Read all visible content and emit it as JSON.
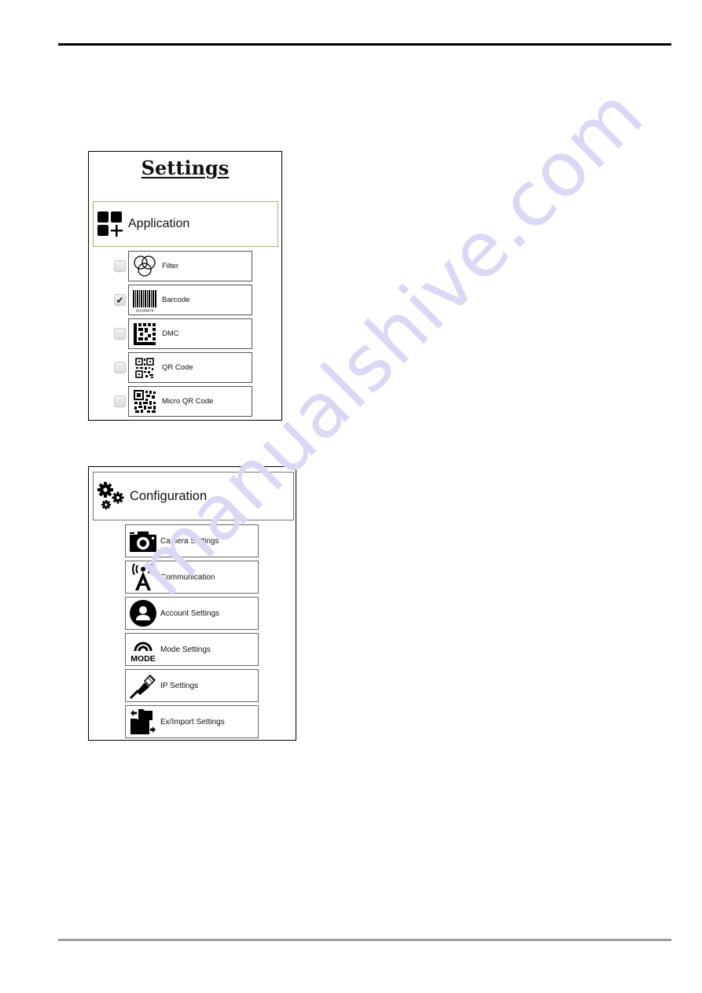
{
  "settings_panel": {
    "title": "Settings",
    "application_header": {
      "label": "Application",
      "icon": "apps-add-icon"
    },
    "items": [
      {
        "label": "Filter",
        "icon": "filter-circles-icon",
        "checked": false
      },
      {
        "label": "Barcode",
        "icon": "barcode-icon",
        "checked": true,
        "barcode_digits": "012345678"
      },
      {
        "label": "DMC",
        "icon": "data-matrix-icon",
        "checked": false
      },
      {
        "label": "QR Code",
        "icon": "qr-code-icon",
        "checked": false
      },
      {
        "label": "Micro QR Code",
        "icon": "micro-qr-code-icon",
        "checked": false
      }
    ],
    "check_glyph": "✔",
    "header_border_color": "#b8a878"
  },
  "configuration_panel": {
    "header": {
      "label": "Configuration",
      "icon": "gears-icon"
    },
    "items": [
      {
        "label": "Camera Settings",
        "icon": "camera-icon"
      },
      {
        "label": "Communication",
        "icon": "antenna-icon"
      },
      {
        "label": "Account Settings",
        "icon": "account-icon"
      },
      {
        "label": "Mode Settings",
        "icon": "mode-icon",
        "icon_text": "MODE"
      },
      {
        "label": "IP Settings",
        "icon": "ethernet-cable-icon"
      },
      {
        "label": "Ex/Import Settings",
        "icon": "folder-transfer-icon"
      }
    ]
  },
  "watermark": {
    "text": "manualshive.com",
    "color": "#d9d9f6"
  }
}
